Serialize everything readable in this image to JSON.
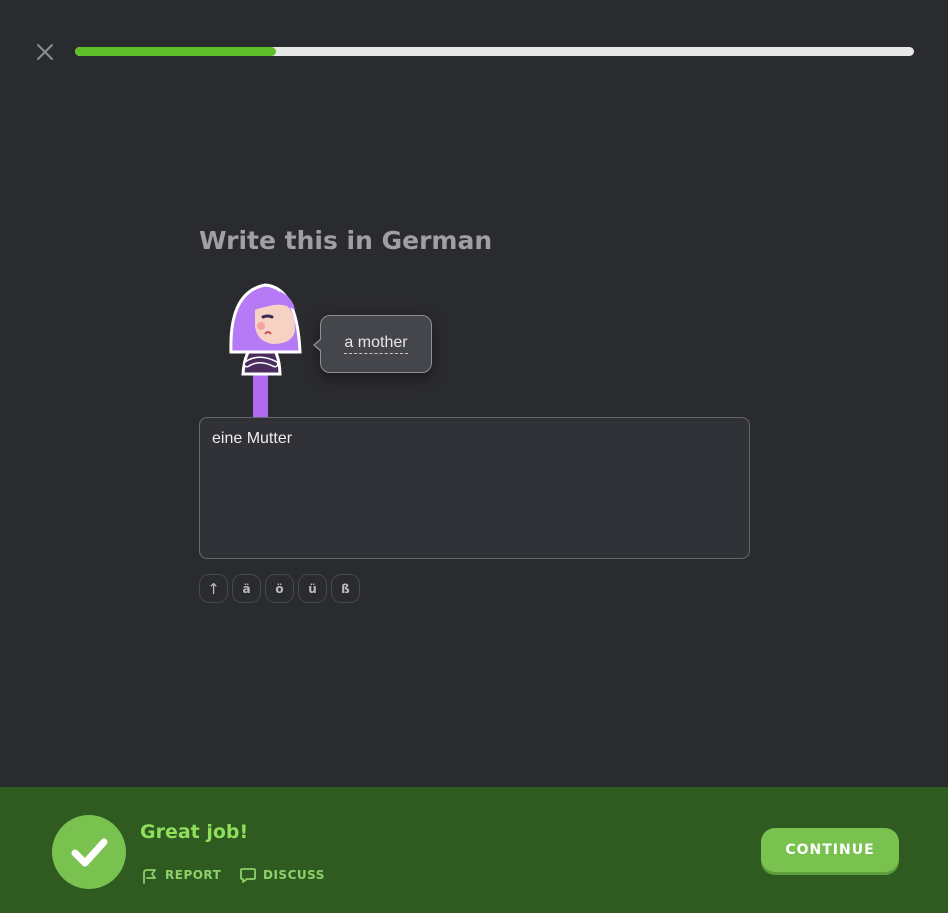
{
  "header": {
    "close_icon": "close-icon",
    "progress": 0.24
  },
  "prompt": {
    "title": "Write this in German",
    "phrase": "a mother"
  },
  "answer": {
    "value": "eine Mutter"
  },
  "special_keys": {
    "shift": "↑",
    "a_umlaut": "ä",
    "o_umlaut": "ö",
    "u_umlaut": "ü",
    "eszett": "ß"
  },
  "footer": {
    "status": "Great job!",
    "report_label": "REPORT",
    "discuss_label": "DISCUSS",
    "continue_label": "CONTINUE",
    "background_color": "#2f5a20",
    "accent_color": "#79c24f"
  }
}
